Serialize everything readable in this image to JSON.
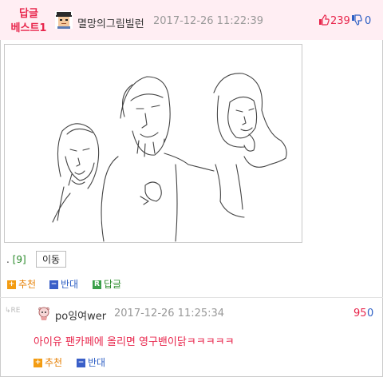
{
  "best_reply": {
    "label_line1": "답글",
    "label_line2": "베스트1",
    "author": "멸망의그림빌런",
    "timestamp": "2017-12-26 11:22:39",
    "up_count": "239",
    "down_count": "0"
  },
  "post": {
    "ref_dot": ". ",
    "ref_num": "[9]",
    "move_label": "이동",
    "actions": {
      "recommend_label": "추천",
      "oppose_label": "반대",
      "reply_label": "답글"
    }
  },
  "reply": {
    "re_tag": "↳RE",
    "author": "po잉여wer",
    "timestamp": "2017-12-26 11:25:34",
    "up_count": "95",
    "down_count": "0",
    "body": "아이유 팬카페에 올리면 영구밴이닭ㅋㅋㅋㅋㅋ",
    "actions": {
      "recommend_label": "추천",
      "oppose_label": "반대"
    }
  },
  "icons": {
    "plus": "+",
    "minus": "−",
    "reply": "R"
  },
  "colors": {
    "header_bg": "#ffeef3",
    "accent_red": "#e8264c",
    "accent_blue": "#2d5fc4",
    "orange": "#f39c12",
    "green": "#3aa04a"
  }
}
